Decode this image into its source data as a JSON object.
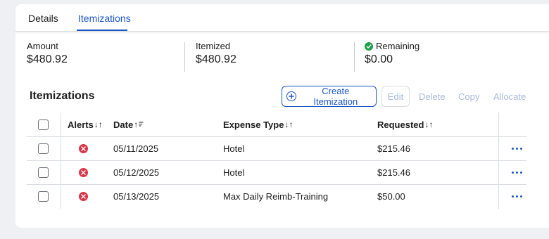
{
  "tabs": [
    {
      "label": "Details"
    },
    {
      "label": "Itemizations"
    }
  ],
  "summary": {
    "amount": {
      "label": "Amount",
      "value": "$480.92"
    },
    "itemized": {
      "label": "Itemized",
      "value": "$480.92"
    },
    "remaining": {
      "label": "Remaining",
      "value": "$0.00",
      "status_icon": "check-circle-icon",
      "status_color": "#1e9e4a"
    }
  },
  "section": {
    "title": "Itemizations",
    "buttons": {
      "create": "Create Itemization",
      "edit": "Edit",
      "delete": "Delete",
      "copy": "Copy",
      "allocate": "Allocate"
    }
  },
  "table": {
    "headers": {
      "alerts": "Alerts",
      "date": "Date",
      "expense_type": "Expense Type",
      "requested": "Requested"
    },
    "sort_icons": {
      "alerts": "↓↑",
      "date": "↑",
      "expense_type": "↓↑",
      "requested": "↓↑"
    },
    "rows": [
      {
        "date": "05/11/2025",
        "expense_type": "Hotel",
        "requested": "$215.46",
        "alert_icon": "error-icon"
      },
      {
        "date": "05/12/2025",
        "expense_type": "Hotel",
        "requested": "$215.46",
        "alert_icon": "error-icon"
      },
      {
        "date": "05/13/2025",
        "expense_type": "Max Daily Reimb-Training",
        "requested": "$50.00",
        "alert_icon": "error-icon"
      }
    ]
  },
  "colors": {
    "accent": "#1a56c4",
    "error": "#d93447",
    "success": "#1e9e4a",
    "disabled": "#a7b9d8"
  }
}
